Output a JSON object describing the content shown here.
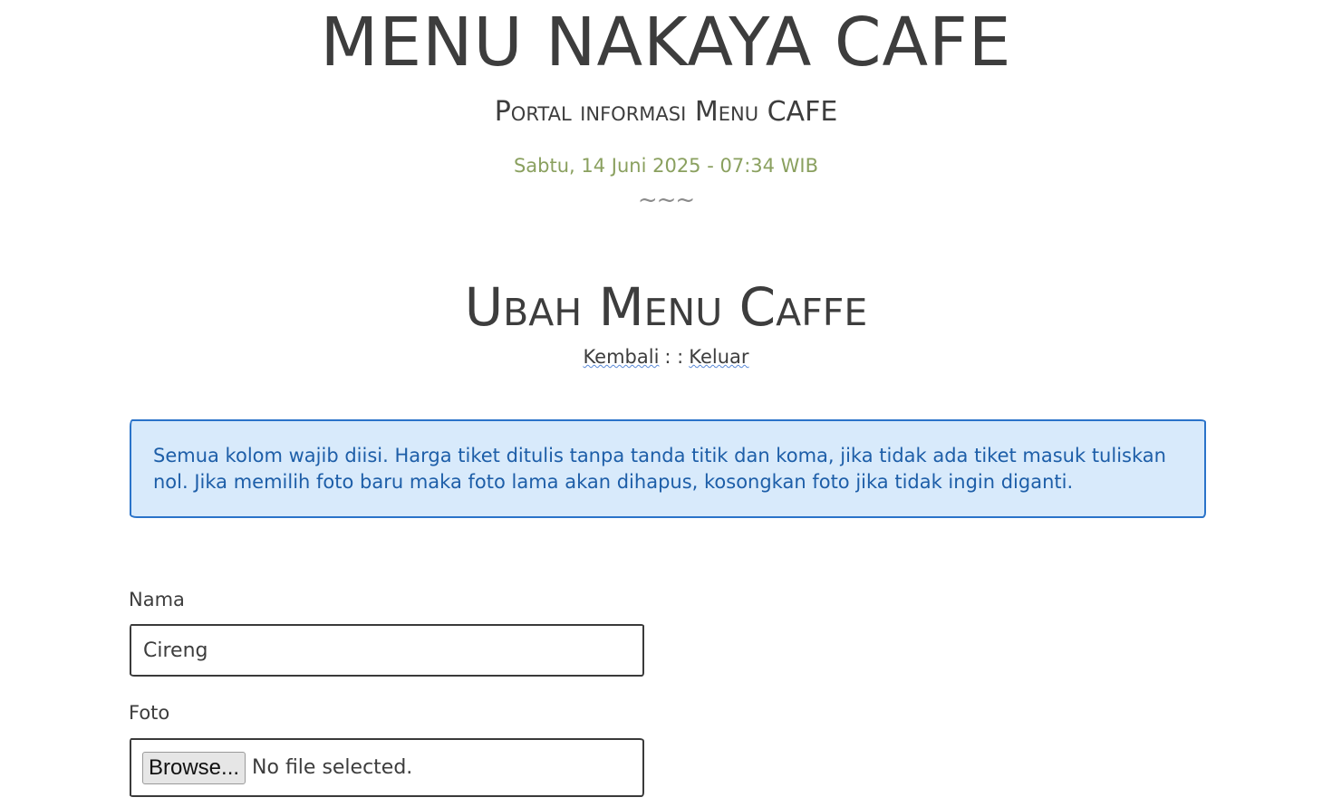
{
  "header": {
    "title": "MENU NAKAYA CAFE",
    "subtitle": "Portal informasi Menu CAFE",
    "datetime": "Sabtu, 14 Juni 2025 - 07:34 WIB",
    "divider": "~~~"
  },
  "page": {
    "heading": "Ubah Menu Caffe"
  },
  "nav": {
    "back_label": "Kembali",
    "separator": ": :",
    "logout_label": "Keluar"
  },
  "alert": {
    "message": "Semua kolom wajib diisi. Harga tiket ditulis tanpa tanda titik dan koma, jika tidak ada tiket masuk tuliskan nol. Jika memilih foto baru maka foto lama akan dihapus, kosongkan foto jika tidak ingin diganti."
  },
  "form": {
    "nama_label": "Nama",
    "nama_value": "Cireng",
    "foto_label": "Foto",
    "browse_label": "Browse...",
    "file_status": "No file selected."
  },
  "colors": {
    "text": "#3d3d3d",
    "datetime": "#8aa05f",
    "alert_bg": "#d8eafb",
    "alert_border": "#2a73c9",
    "alert_text": "#1d5ea8"
  }
}
